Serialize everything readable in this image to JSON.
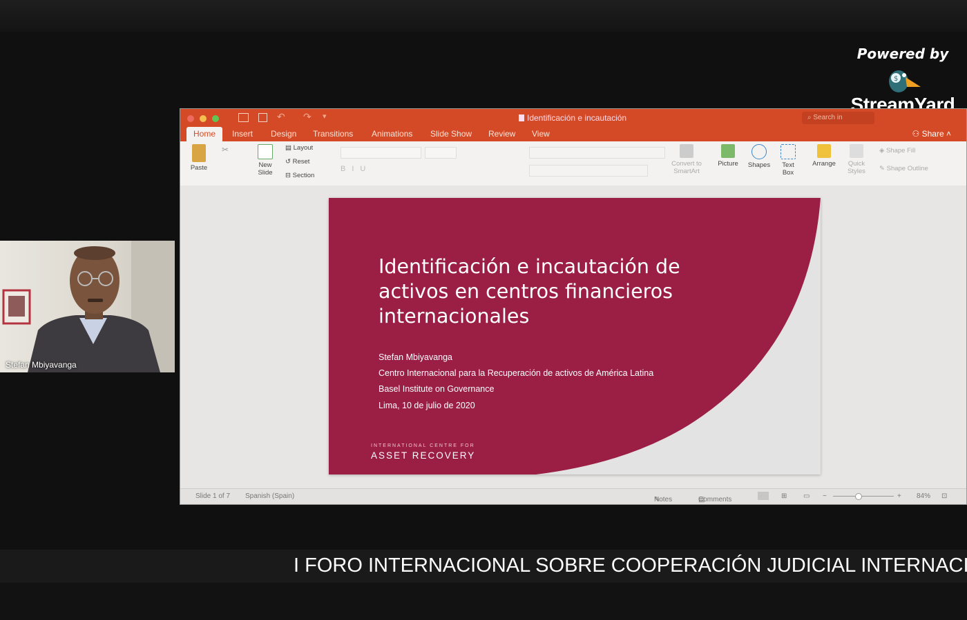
{
  "branding": {
    "powered_by": "Powered by",
    "name": "StreamYard"
  },
  "participant": {
    "name": "Stefan Mbiyavanga"
  },
  "powerpoint": {
    "window_title": "Identificación e incautación",
    "search_placeholder": "Search in",
    "share_label": "Share",
    "tabs": [
      "Home",
      "Insert",
      "Design",
      "Transitions",
      "Animations",
      "Slide Show",
      "Review",
      "View"
    ],
    "ribbon": {
      "paste": "Paste",
      "new_slide": "New Slide",
      "layout": "Layout",
      "reset": "Reset",
      "section": "Section",
      "convert": "Convert to SmartArt",
      "picture": "Picture",
      "shapes": "Shapes",
      "text_box": "Text Box",
      "arrange": "Arrange",
      "quick_styles": "Quick Styles",
      "shape_fill": "Shape Fill",
      "shape_outline": "Shape Outline"
    },
    "status": {
      "slide": "Slide 1 of 7",
      "language": "Spanish (Spain)",
      "notes": "Notes",
      "comments": "Comments",
      "zoom": "84%"
    }
  },
  "slide": {
    "title_lines": [
      "Identificación e incautación de",
      "activos en centros financieros",
      "internacionales"
    ],
    "author": "Stefan Mbiyavanga",
    "org1": "Centro Internacional para la Recuperación de activos de América Latina",
    "org2": "Basel Institute on Governance",
    "place_date": "Lima, 10 de julio de 2020",
    "footer_small": "INTERNATIONAL CENTRE FOR",
    "footer_big": "ASSET RECOVERY",
    "accent_color": "#9b1f45"
  },
  "ticker": {
    "text": "I FORO INTERNACIONAL SOBRE COOPERACIÓN JUDICIAL INTERNACIO"
  }
}
